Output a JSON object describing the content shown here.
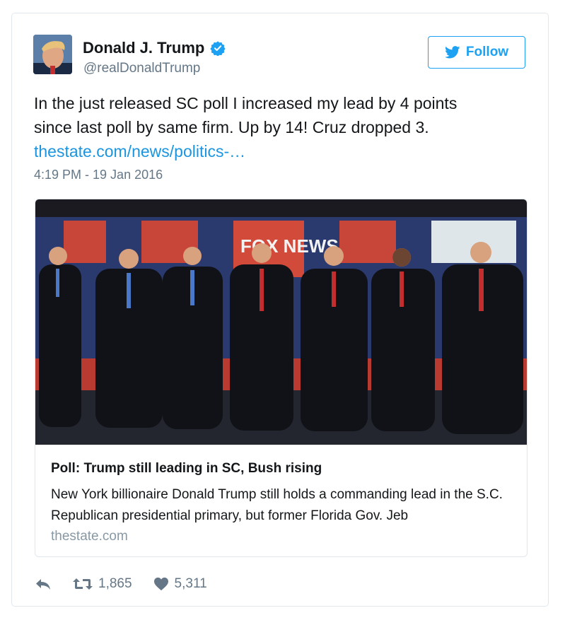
{
  "tweet": {
    "author_name": "Donald J. Trump",
    "handle": "@realDonaldTrump",
    "follow_label": "Follow",
    "text_line1": "In the just released SC poll I increased my lead by 4 points",
    "text_line2": "since last poll by same firm. Up by 14! Cruz dropped 3.",
    "link_text": "thestate.com/news/politics-…",
    "timestamp": "4:19 PM - 19 Jan 2016"
  },
  "card": {
    "stage_logo_text": "FOX NEWS",
    "title": "Poll: Trump still leading in SC, Bush rising",
    "description": "New York billionaire Donald Trump still holds a commanding lead in the S.C. Republican presidential primary, but former Florida Gov. Jeb",
    "domain": "thestate.com"
  },
  "actions": {
    "retweets": "1,865",
    "likes": "5,311"
  },
  "colors": {
    "brand_blue": "#1da1f2",
    "link_blue": "#1b95e0",
    "muted": "#657786"
  }
}
